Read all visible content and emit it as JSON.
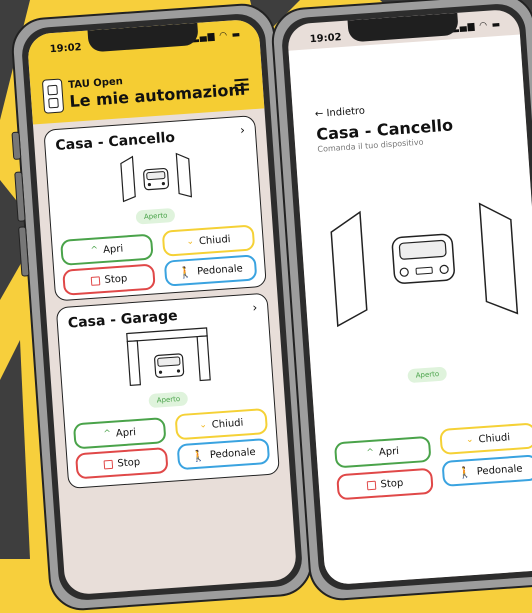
{
  "status_time": "19:02",
  "app": {
    "name": "TAU Open",
    "title": "Le mie automazioni",
    "icon_label": "TAU"
  },
  "devices": [
    {
      "name": "Casa - Cancello",
      "status": "Aperto",
      "buttons": {
        "open": "Apri",
        "close": "Chiudi",
        "stop": "Stop",
        "pedestrian": "Pedonale"
      }
    },
    {
      "name": "Casa - Garage",
      "status": "Aperto",
      "buttons": {
        "open": "Apri",
        "close": "Chiudi",
        "stop": "Stop",
        "pedestrian": "Pedonale"
      }
    }
  ],
  "detail": {
    "back_label": "Indietro",
    "title": "Casa - Cancello",
    "subtitle": "Comanda il tuo dispositivo",
    "status": "Aperto",
    "buttons": {
      "open": "Apri",
      "close": "Chiudi",
      "stop": "Stop",
      "pedestrian": "Pedonale"
    }
  },
  "colors": {
    "brand_yellow": "#f5cd33",
    "open_green": "#4aa34a",
    "close_yellow": "#f5d136",
    "stop_red": "#e04848",
    "pedestrian_blue": "#3aa3e0"
  }
}
